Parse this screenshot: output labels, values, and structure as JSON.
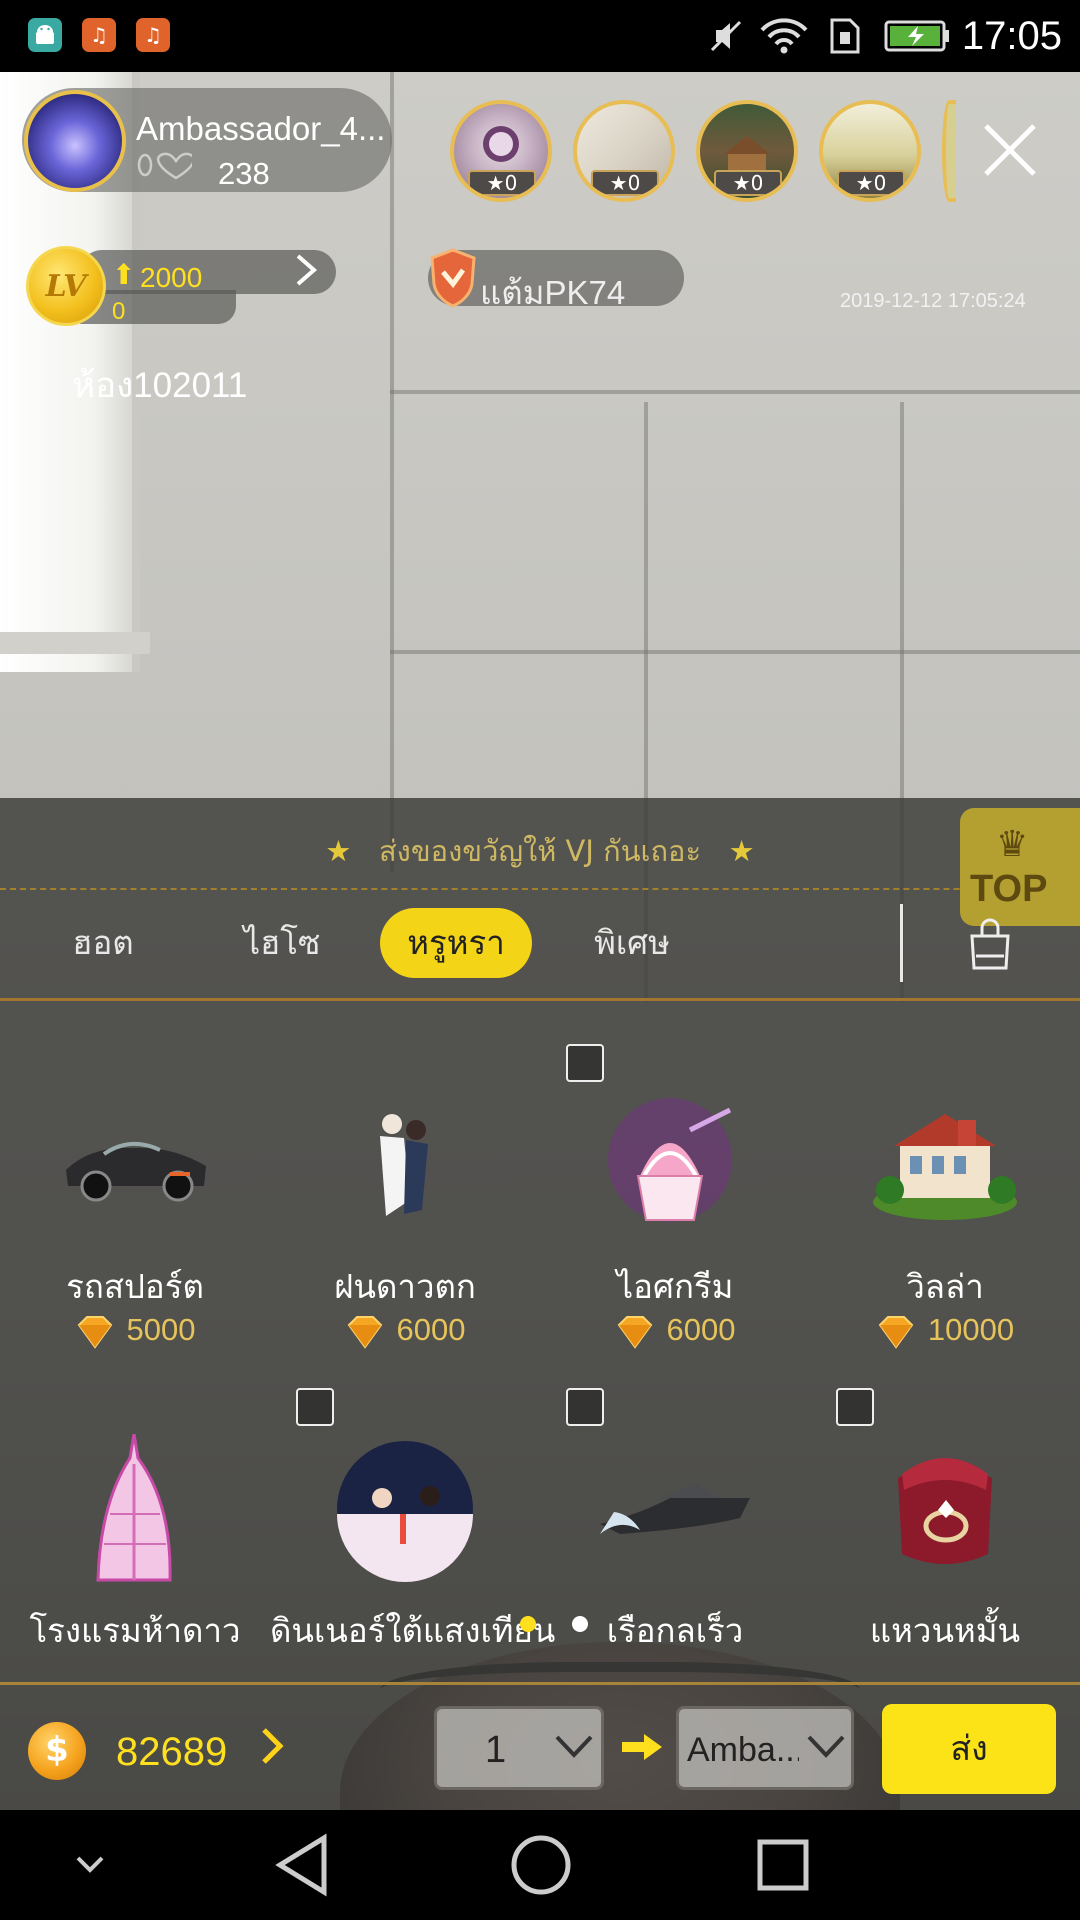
{
  "status_bar": {
    "time": "17:05",
    "left_icons": [
      "android-icon",
      "music-app-icon",
      "music-app-icon"
    ],
    "right_icons": [
      "mute-icon",
      "wifi-icon",
      "sim-icon",
      "battery-charging-icon"
    ]
  },
  "streamer": {
    "name": "Ambassador_4...",
    "fans": "238"
  },
  "viewers": [
    {
      "stars": "0"
    },
    {
      "stars": "0"
    },
    {
      "stars": "0"
    },
    {
      "stars": "0"
    }
  ],
  "level": {
    "badge": "LV",
    "target": "2000",
    "current": "0"
  },
  "pk": {
    "label": "แต้มPK74"
  },
  "timestamp": "2019-12-12 17:05:24",
  "room": {
    "label": "ห้อง102011"
  },
  "gift_panel": {
    "promo": "ส่งของขวัญให้ VJ กันเถอะ",
    "top_label": "TOP",
    "tabs": [
      {
        "label": "ฮอต",
        "active": false
      },
      {
        "label": "ไฮโซ",
        "active": false
      },
      {
        "label": "หรูหรา",
        "active": true
      },
      {
        "label": "พิเศษ",
        "active": false
      }
    ],
    "gifts": [
      {
        "name": "รถสปอร์ต",
        "price": "5000",
        "icon": "sports-car-icon"
      },
      {
        "name": "ฝนดาวตก",
        "price": "6000",
        "icon": "meteor-couple-icon"
      },
      {
        "name": "ไอศกรีม",
        "price": "6000",
        "icon": "ice-cream-icon"
      },
      {
        "name": "วิลล่า",
        "price": "10000",
        "icon": "villa-icon"
      },
      {
        "name": "โรงแรมห้าดาว",
        "price": "",
        "icon": "hotel-icon"
      },
      {
        "name": "ดินเนอร์ใต้แสงเทียน",
        "price": "",
        "icon": "candle-dinner-icon"
      },
      {
        "name": "เรือกลเร็ว",
        "price": "",
        "icon": "speedboat-icon"
      },
      {
        "name": "แหวนหมั้น",
        "price": "",
        "icon": "engagement-ring-icon"
      }
    ],
    "page_indicator": {
      "pages": 2,
      "current": 1
    }
  },
  "bottom_bar": {
    "balance": "82689",
    "quantity": "1",
    "receiver": "Amba...",
    "send_label": "ส่ง"
  },
  "colors": {
    "accent_yellow": "#f3d417",
    "gold": "#e6c35b",
    "panel_bg": "#3a3a38"
  }
}
